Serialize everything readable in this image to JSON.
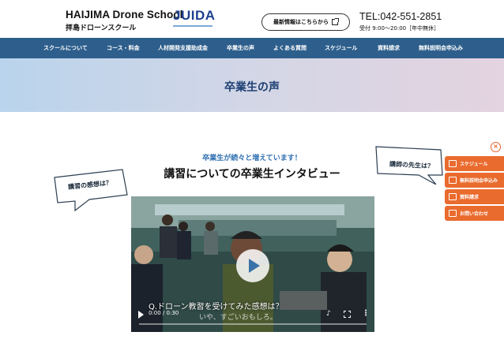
{
  "header": {
    "title": "HAIJIMA Drone School",
    "subtitle": "拝島ドローンスクール",
    "partner_logo": "JUIDA",
    "news_button": "最新情報はこちらから",
    "tel": "TEL:042-551-2851",
    "hours": "受付 9:00〜20:00［年中無休］"
  },
  "nav": {
    "items": [
      "スクールについて",
      "コース・料金",
      "人材開発支援助成金",
      "卒業生の声",
      "よくある質問",
      "スケジュール",
      "資料請求",
      "無料説明会申込み"
    ]
  },
  "hero": {
    "title": "卒業生の声"
  },
  "section": {
    "subtitle": "卒業生が続々と増えています！",
    "title": "講習についての卒業生インタビュー",
    "bubble_left": "講習の感想は？",
    "bubble_right": "講師の先生は？"
  },
  "video": {
    "caption": "Q.ドローン教習を受けてみた感想は？",
    "subcaption": "いや、すごいおもしろ。",
    "time": "0:00 / 0:30"
  },
  "side": {
    "close": "×",
    "buttons": [
      {
        "label": "スケジュール",
        "icon": "calendar-icon"
      },
      {
        "label": "無料説明会申込み",
        "icon": "briefcase-icon"
      },
      {
        "label": "資料請求",
        "icon": "document-icon"
      },
      {
        "label": "お問い合わせ",
        "icon": "mail-icon"
      }
    ]
  },
  "colors": {
    "nav_bg": "#2e5f8c",
    "accent_orange": "#ea6b2e",
    "hero_title": "#1c3f73",
    "subtitle_blue": "#2e6fb0"
  }
}
